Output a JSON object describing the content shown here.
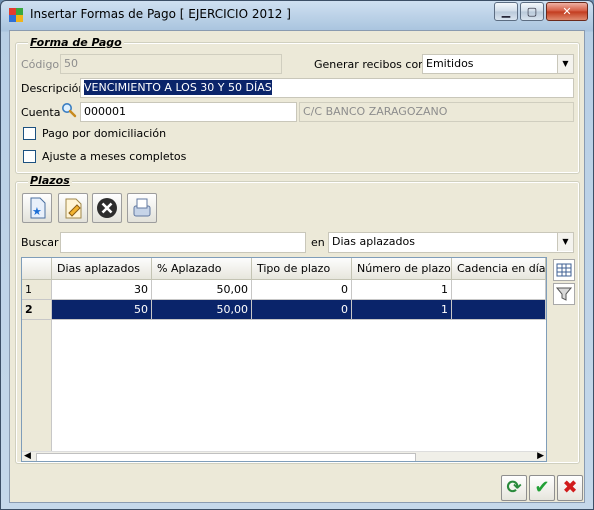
{
  "window": {
    "title": "Insertar Formas de Pago [ EJERCICIO 2012 ]"
  },
  "forma_pago": {
    "legend": "Forma de Pago",
    "codigo_label": "Código",
    "codigo_value": "50",
    "generar_label": "Generar recibos como",
    "generar_value": "Emitidos",
    "descripcion_label": "Descripción",
    "descripcion_value": "VENCIMIENTO A LOS 30 Y 50 DÍAS",
    "cuenta_label": "Cuenta",
    "cuenta_value": "000001",
    "cuenta_name": "C/C BANCO ZARAGOZANO",
    "pago_domiciliacion_label": "Pago por domiciliación",
    "ajuste_meses_label": "Ajuste a meses completos"
  },
  "plazos": {
    "legend": "Plazos",
    "buscar_label": "Buscar",
    "buscar_value": "",
    "en_label": "en",
    "en_value": "Dias aplazados",
    "columns": [
      "Dias aplazados",
      "% Aplazado",
      "Tipo de plazo",
      "Número de plazos",
      "Cadencia en días"
    ],
    "rows": [
      {
        "index": "1",
        "cells": [
          "30",
          "50,00",
          "0",
          "1",
          ""
        ]
      },
      {
        "index": "2",
        "cells": [
          "50",
          "50,00",
          "0",
          "1",
          ""
        ]
      }
    ]
  },
  "colors": {
    "selection": "#0a246a",
    "window_bg": "#ece9d8"
  }
}
